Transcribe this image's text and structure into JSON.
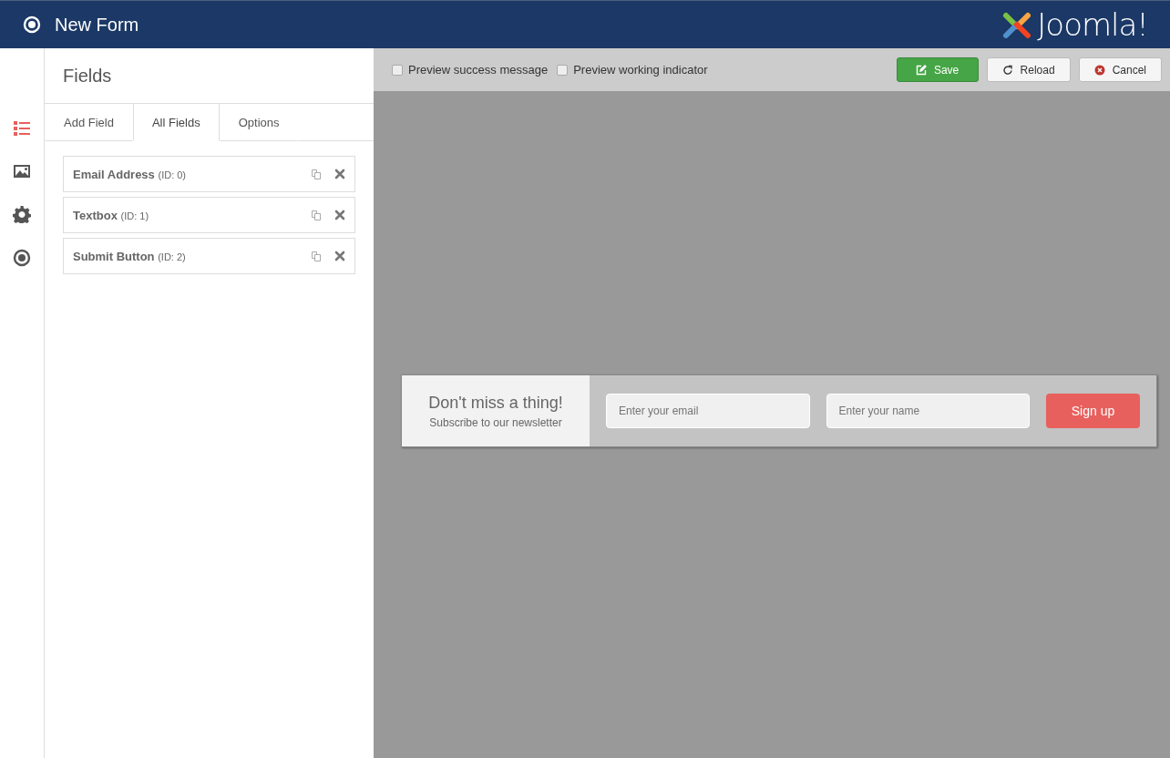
{
  "header": {
    "title": "New Form",
    "logo_text": "Joomla!"
  },
  "side_nav": [
    {
      "kind": "list",
      "selected": true
    },
    {
      "kind": "image",
      "selected": false
    },
    {
      "kind": "gear",
      "selected": false
    },
    {
      "kind": "target",
      "selected": false
    }
  ],
  "panel": {
    "title": "Fields",
    "tabs": [
      {
        "label": "Add Field",
        "selected": false
      },
      {
        "label": "All Fields",
        "selected": true
      },
      {
        "label": "Options",
        "selected": false
      }
    ],
    "fields": [
      {
        "name": "Email Address",
        "id": "(ID: 0)"
      },
      {
        "name": "Textbox",
        "id": "(ID: 1)"
      },
      {
        "name": "Submit Button",
        "id": "(ID: 2)"
      }
    ]
  },
  "toolbar": {
    "checkboxes": [
      {
        "label": "Preview success message",
        "checked": false
      },
      {
        "label": "Preview working indicator",
        "checked": false
      }
    ],
    "buttons": [
      {
        "kind": "save",
        "label": "Save"
      },
      {
        "kind": "reload",
        "label": "Reload"
      },
      {
        "kind": "cancel",
        "label": "Cancel"
      }
    ]
  },
  "form_preview": {
    "heading": "Don't miss a thing!",
    "subheading": "Subscribe to our newsletter",
    "email_placeholder": "Enter your email",
    "name_placeholder": "Enter your name",
    "button": "Sign up"
  }
}
